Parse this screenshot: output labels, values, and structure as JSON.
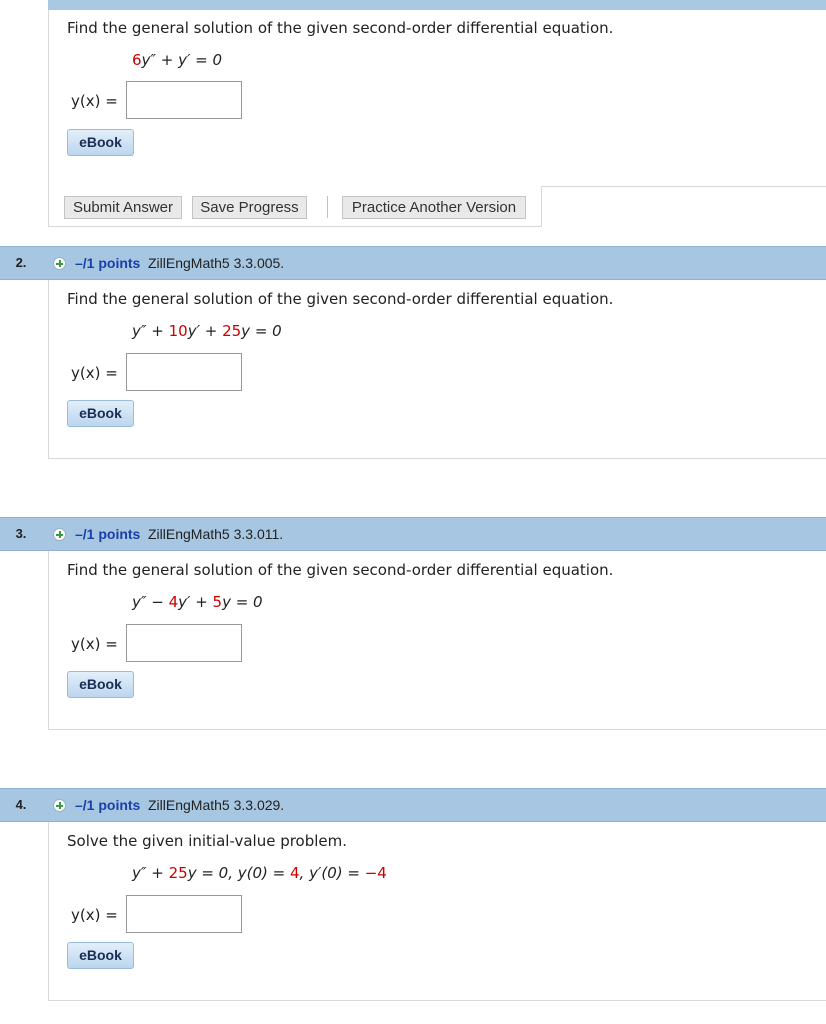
{
  "labels": {
    "answer": "y(x) =",
    "ebook": "eBook",
    "submit": "Submit Answer",
    "save": "Save Progress",
    "practice": "Practice Another Version"
  },
  "questions": [
    {
      "prompt": "Find the general solution of the given second-order differential equation.",
      "equation_parts": [
        "6",
        "y″ + y′ = 0"
      ]
    },
    {
      "number": "2.",
      "points": "–/1 points",
      "source": "ZillEngMath5 3.3.005.",
      "prompt": "Find the general solution of the given second-order differential equation.",
      "equation_parts": [
        "y″ + ",
        "10",
        "y′ + ",
        "25",
        "y = 0"
      ]
    },
    {
      "number": "3.",
      "points": "–/1 points",
      "source": "ZillEngMath5 3.3.011.",
      "prompt": "Find the general solution of the given second-order differential equation.",
      "equation_parts": [
        "y″ − ",
        "4",
        "y′ + ",
        "5",
        "y = 0"
      ]
    },
    {
      "number": "4.",
      "points": "–/1 points",
      "source": "ZillEngMath5 3.3.029.",
      "prompt": "Solve the given initial-value problem.",
      "equation_parts": [
        "y″ + ",
        "25",
        "y = 0,  y(0) = ",
        "4",
        ",  y′(0) = ",
        "−4"
      ]
    }
  ],
  "colors": {
    "header_bg": "#a7c6e1",
    "points_text": "#1b3fa8",
    "coefficient_red": "#cc0000",
    "ebook_bg": "#c9def3"
  }
}
